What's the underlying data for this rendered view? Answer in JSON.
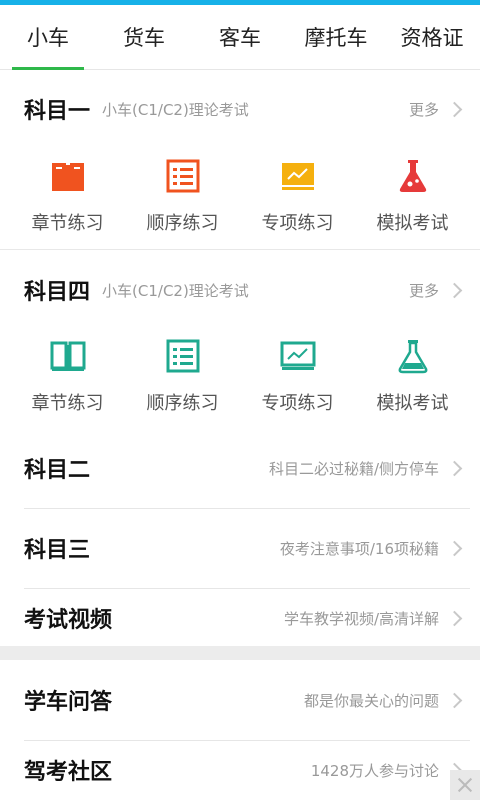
{
  "tabs": [
    {
      "label": "小车",
      "active": true
    },
    {
      "label": "货车",
      "active": false
    },
    {
      "label": "客车",
      "active": false
    },
    {
      "label": "摩托车",
      "active": false
    },
    {
      "label": "资格证",
      "active": false
    }
  ],
  "subject1": {
    "title": "科目一",
    "subtitle": "小车(C1/C2)理论考试",
    "more": "更多",
    "items": [
      {
        "label": "章节练习",
        "icon": "book-icon",
        "color": "#f0531f"
      },
      {
        "label": "顺序练习",
        "icon": "list-icon",
        "color": "#f0531f"
      },
      {
        "label": "专项练习",
        "icon": "chart-board-icon",
        "color": "#f5b00e"
      },
      {
        "label": "模拟考试",
        "icon": "flask-icon",
        "color": "#e63a3a"
      }
    ]
  },
  "subject4": {
    "title": "科目四",
    "subtitle": "小车(C1/C2)理论考试",
    "more": "更多",
    "items": [
      {
        "label": "章节练习",
        "icon": "book-icon",
        "color": "#1fa98f"
      },
      {
        "label": "顺序练习",
        "icon": "list-icon",
        "color": "#1fa98f"
      },
      {
        "label": "专项练习",
        "icon": "chart-board-icon",
        "color": "#1fa98f"
      },
      {
        "label": "模拟考试",
        "icon": "flask-icon",
        "color": "#1fa98f"
      }
    ]
  },
  "rows": [
    {
      "title": "科目二",
      "desc": "科目二必过秘籍/侧方停车"
    },
    {
      "title": "科目三",
      "desc": "夜考注意事项/16项秘籍"
    },
    {
      "title": "考试视频",
      "desc": "学车教学视频/高清详解"
    },
    {
      "title": "学车问答",
      "desc": "都是你最关心的问题"
    },
    {
      "title": "驾考社区",
      "desc": "1428万人参与讨论"
    }
  ]
}
